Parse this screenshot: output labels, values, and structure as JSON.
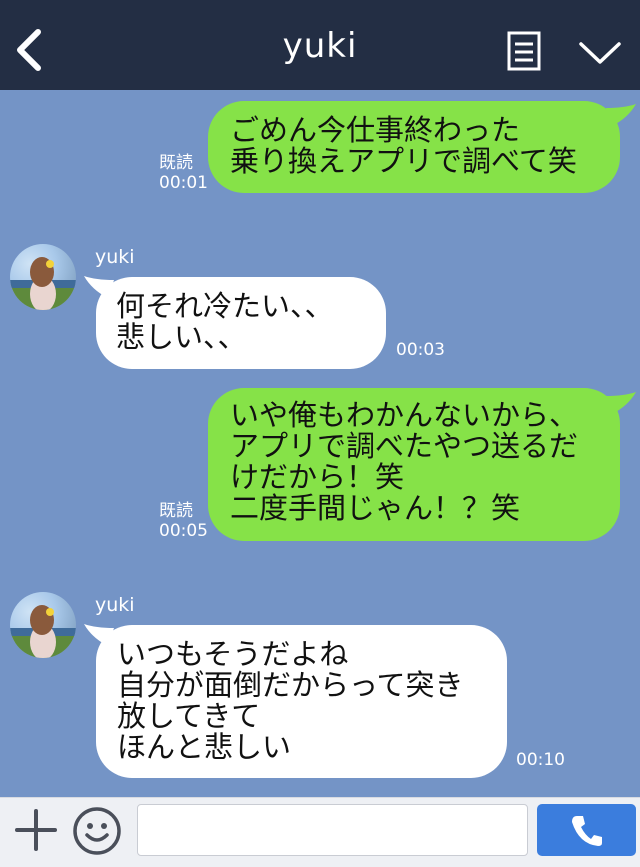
{
  "header": {
    "title": "yuki",
    "back_icon": "chevron-left-icon",
    "menu_icon": "notes-icon",
    "expand_icon": "chevron-down-icon"
  },
  "messages": [
    {
      "side": "out",
      "text": "ごめん今仕事終わった\n乗り換えアプリで調べて笑",
      "read": "既読",
      "time": "00:01"
    },
    {
      "side": "in",
      "sender": "yuki",
      "text": "何それ冷たい、、\n悲しい、、",
      "time": "00:03"
    },
    {
      "side": "out",
      "text": "いや俺もわかんないから、\nアプリで調べたやつ送るだ\nけだから！笑\n二度手間じゃん！？笑",
      "read": "既読",
      "time": "00:05"
    },
    {
      "side": "in",
      "sender": "yuki",
      "text": "いつもそうだよね\n自分が面倒だからって突き\n放してきて\nほんと悲しい",
      "time": "00:10"
    }
  ],
  "footer": {
    "plus_icon": "plus-icon",
    "emoji_icon": "smiley-icon",
    "input_value": "",
    "call_icon": "phone-icon"
  },
  "colors": {
    "background": "#7494c6",
    "header": "#232e44",
    "outgoing": "#86e248",
    "incoming": "#ffffff",
    "call_button": "#3b7ddd"
  }
}
